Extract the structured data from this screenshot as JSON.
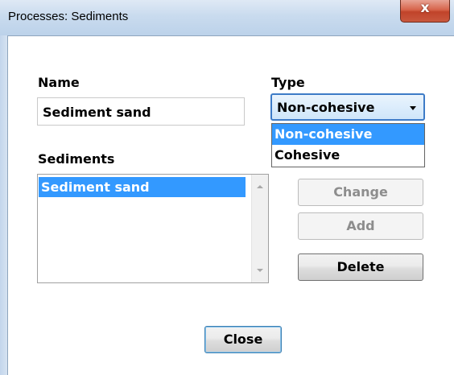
{
  "window": {
    "title": "Processes: Sediments",
    "close_glyph": "x"
  },
  "name": {
    "label": "Name",
    "value": "Sediment sand"
  },
  "type": {
    "label": "Type",
    "selected": "Non-cohesive",
    "options": [
      "Non-cohesive",
      "Cohesive"
    ]
  },
  "sediments": {
    "label": "Sediments",
    "items": [
      "Sediment sand"
    ]
  },
  "buttons": {
    "change": "Change",
    "add": "Add",
    "delete": "Delete",
    "close": "Close"
  },
  "colors": {
    "selection": "#3399ff",
    "focus_border": "#3d7bc7"
  }
}
